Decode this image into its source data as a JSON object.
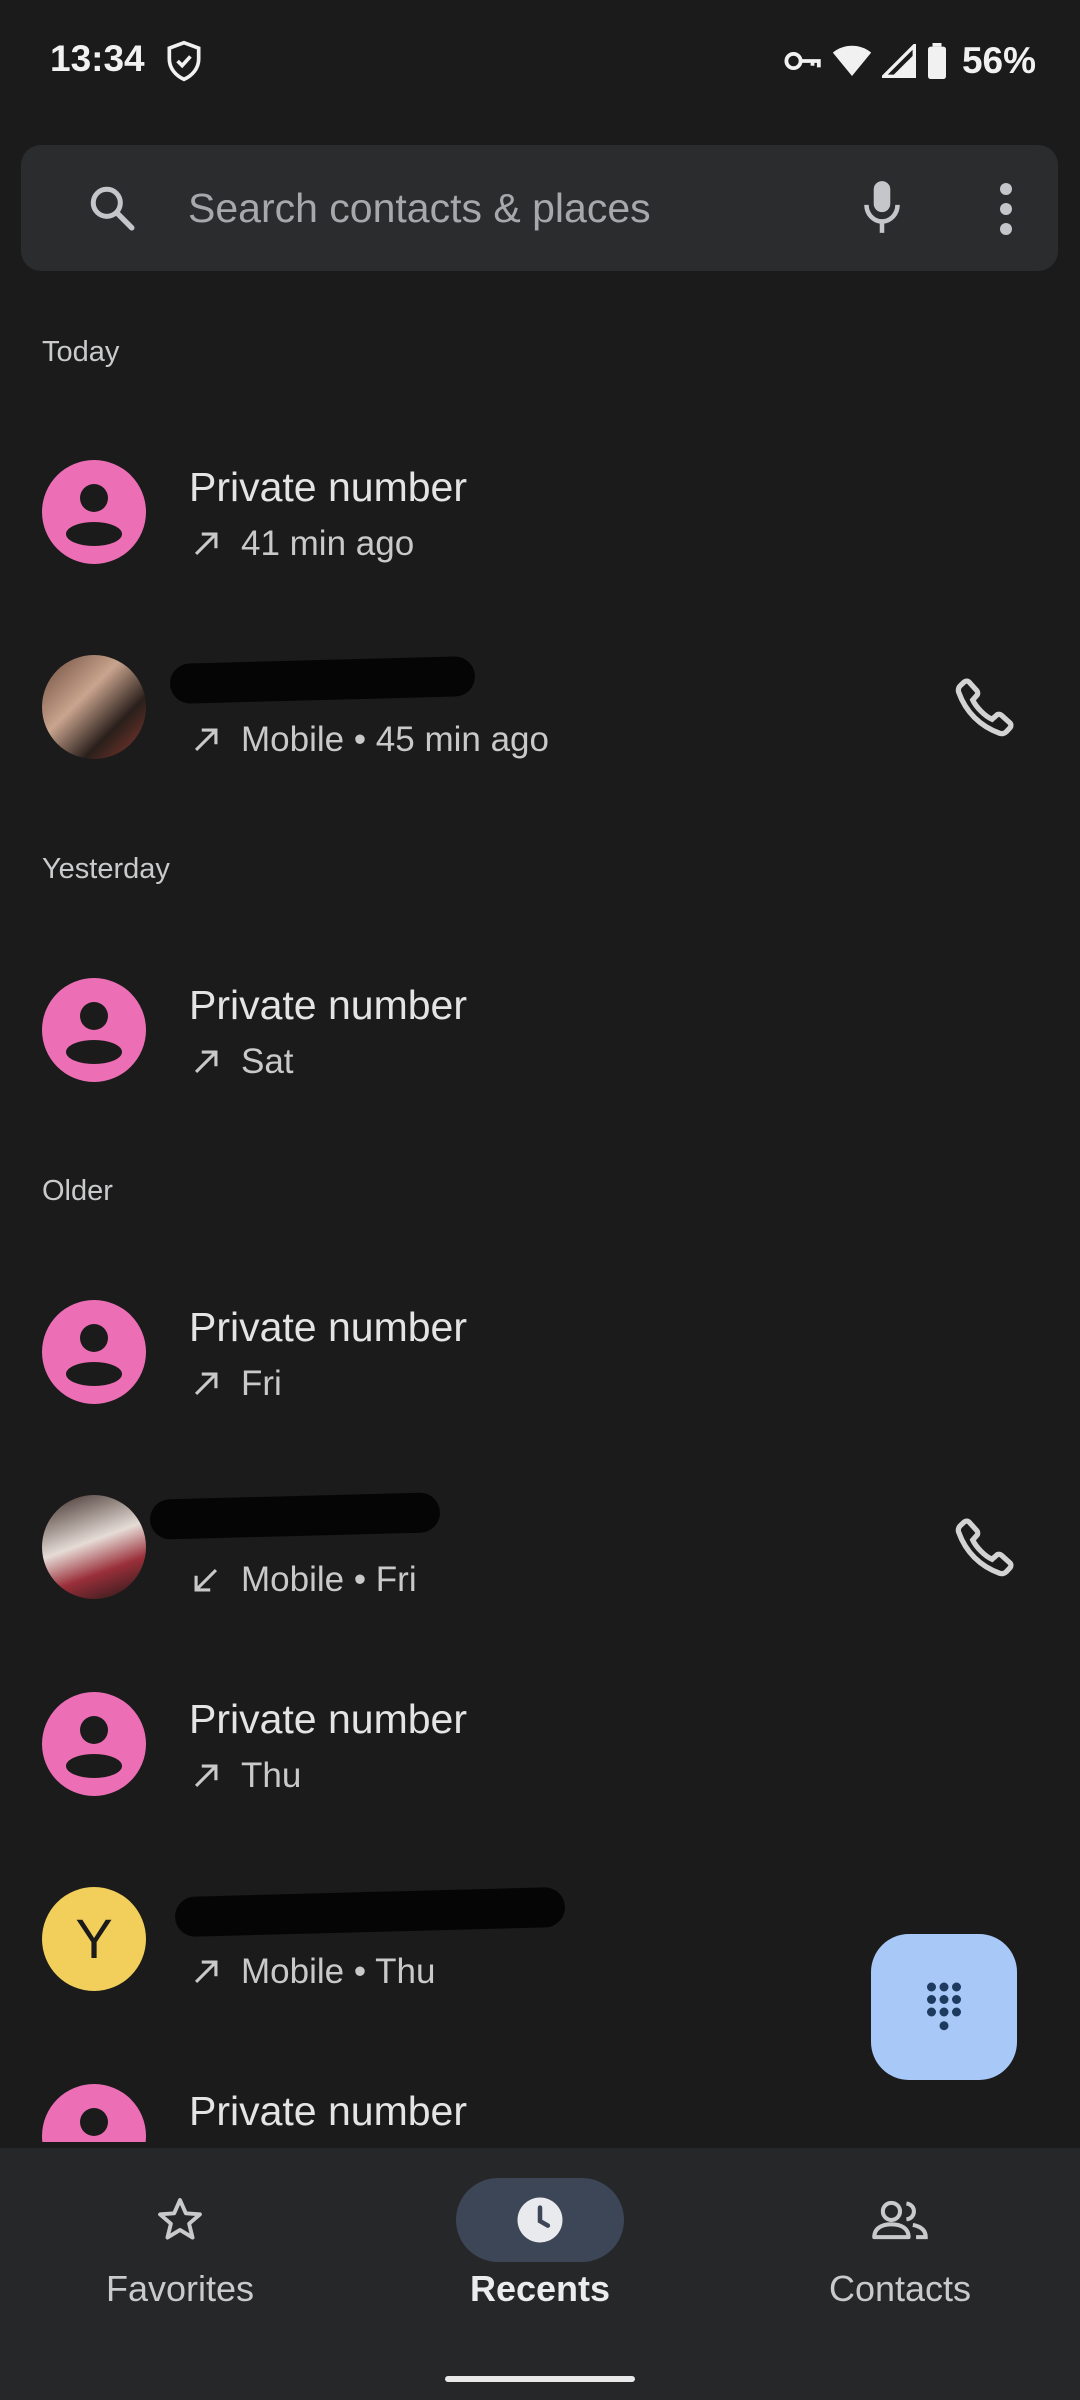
{
  "status_bar": {
    "time": "13:34",
    "battery": "56%",
    "icons": [
      "shield-icon",
      "vpn-key-icon",
      "wifi-icon",
      "signal-icon",
      "battery-icon"
    ]
  },
  "search": {
    "placeholder": "Search contacts & places"
  },
  "sections": {
    "today": "Today",
    "yesterday": "Yesterday",
    "older": "Older"
  },
  "calls": [
    {
      "name": "Private number",
      "detail": "41 min ago",
      "direction": "outgoing",
      "avatar": "person-icon"
    },
    {
      "name": "",
      "detail": "Mobile • 45 min ago",
      "direction": "outgoing",
      "avatar": "photo"
    },
    {
      "name": "Private number",
      "detail": "Sat",
      "direction": "outgoing",
      "avatar": "person-icon"
    },
    {
      "name": "Private number",
      "detail": "Fri",
      "direction": "outgoing",
      "avatar": "person-icon"
    },
    {
      "name": "",
      "detail": "Mobile • Fri",
      "direction": "incoming",
      "avatar": "photo"
    },
    {
      "name": "Private number",
      "detail": "Thu",
      "direction": "outgoing",
      "avatar": "person-icon"
    },
    {
      "name": "",
      "detail": "Mobile • Thu",
      "direction": "outgoing",
      "avatar": "Y"
    },
    {
      "name": "Private number",
      "detail": "",
      "direction": "outgoing",
      "avatar": "person-icon"
    }
  ],
  "nav": {
    "favorites": "Favorites",
    "recents": "Recents",
    "contacts": "Contacts",
    "active": "recents"
  },
  "colors": {
    "background": "#1b1b1b",
    "avatar_pink": "#ec6fb5",
    "avatar_yellow": "#f1cf5a",
    "fab": "#a8c8f7",
    "nav_active_pill": "#3d4657"
  }
}
